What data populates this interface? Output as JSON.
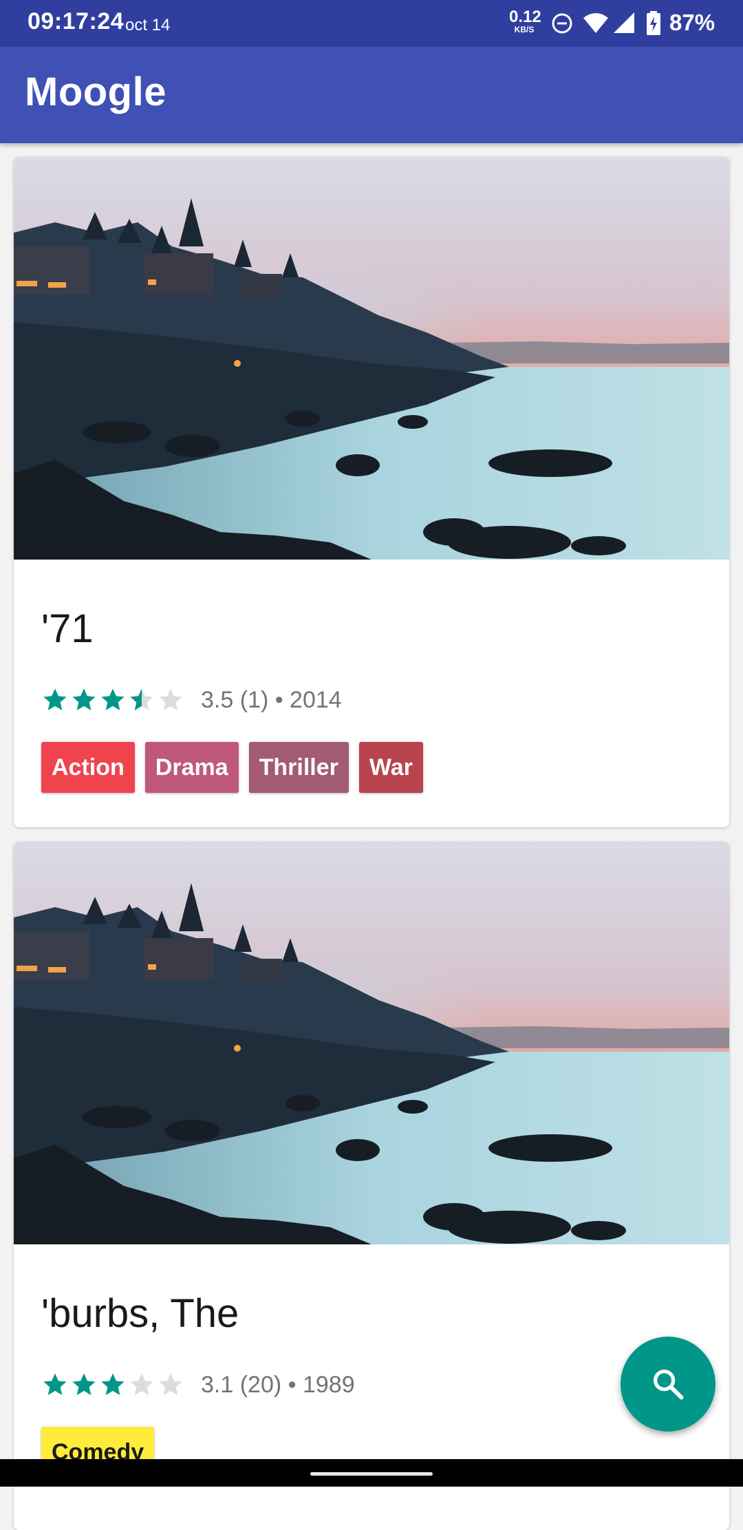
{
  "status_bar": {
    "time": "09:17:24",
    "date": "oct 14",
    "net_speed_value": "0.12",
    "net_speed_unit": "KB/S",
    "battery": "87%",
    "icons": [
      "dnd-icon",
      "wifi-icon",
      "signal-icon",
      "battery-charging-icon"
    ]
  },
  "app_bar": {
    "title": "Moogle"
  },
  "movies": [
    {
      "title": "'71",
      "rating": 3.5,
      "meta": "3.5 (1) • 2014",
      "genres": [
        {
          "label": "Action",
          "color": "#f0434d"
        },
        {
          "label": "Drama",
          "color": "#c0587a"
        },
        {
          "label": "Thriller",
          "color": "#a35b72"
        },
        {
          "label": "War",
          "color": "#b8434d"
        }
      ]
    },
    {
      "title": "'burbs, The",
      "rating": 3.1,
      "meta": "3.1 (20) • 1989",
      "genres": [
        {
          "label": "Comedy",
          "color": "#ffeb3b",
          "text_color": "#1a1a1a"
        }
      ]
    }
  ],
  "fab": {
    "icon": "search-icon",
    "color": "#009688"
  },
  "colors": {
    "status_bar": "#303f9f",
    "app_bar": "#3f51b5",
    "star": "#009688",
    "star_empty": "#dcdcdc"
  }
}
